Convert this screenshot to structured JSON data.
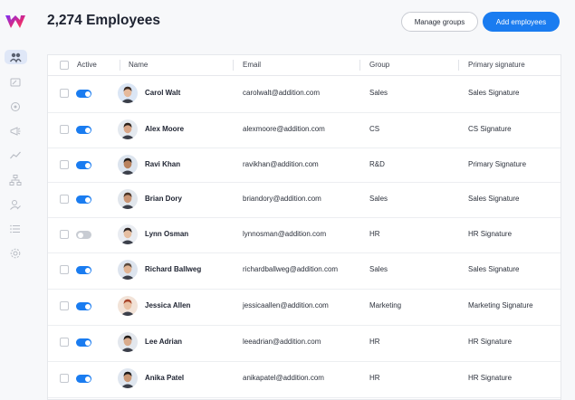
{
  "header": {
    "title": "2,274 Employees",
    "manage_label": "Manage groups",
    "add_label": "Add employees"
  },
  "colors": {
    "accent": "#1a7cf0",
    "toggle_on": "#1a7cf0",
    "toggle_off": "#c8ccd3"
  },
  "sidebar": {
    "items": [
      {
        "icon": "team-icon",
        "active": true
      },
      {
        "icon": "signature-icon"
      },
      {
        "icon": "badge-icon"
      },
      {
        "icon": "megaphone-icon"
      },
      {
        "icon": "analytics-icon"
      },
      {
        "icon": "hierarchy-icon"
      },
      {
        "icon": "user-edit-icon"
      },
      {
        "icon": "list-icon"
      },
      {
        "icon": "settings-icon"
      }
    ]
  },
  "table": {
    "columns": [
      "Active",
      "Name",
      "Email",
      "Group",
      "Primary signature"
    ],
    "rows": [
      {
        "active": true,
        "name": "Carol Walt",
        "email": "carolwalt@addition.com",
        "group": "Sales",
        "signature": "Sales Signature"
      },
      {
        "active": true,
        "name": "Alex Moore",
        "email": "alexmoore@addition.com",
        "group": "CS",
        "signature": "CS Signature"
      },
      {
        "active": true,
        "name": "Ravi Khan",
        "email": "ravikhan@addition.com",
        "group": "R&D",
        "signature": "Primary Signature"
      },
      {
        "active": true,
        "name": "Brian Dory",
        "email": "briandory@addition.com",
        "group": "Sales",
        "signature": "Sales Signature"
      },
      {
        "active": false,
        "name": "Lynn Osman",
        "email": "lynnosman@addition.com",
        "group": "HR",
        "signature": "HR Signature"
      },
      {
        "active": true,
        "name": "Richard Ballweg",
        "email": "richardballweg@addition.com",
        "group": "Sales",
        "signature": "Sales Signature"
      },
      {
        "active": true,
        "name": "Jessica Allen",
        "email": "jessicaallen@addition.com",
        "group": "Marketing",
        "signature": "Marketing Signature"
      },
      {
        "active": true,
        "name": "Lee Adrian",
        "email": "leeadrian@addition.com",
        "group": "HR",
        "signature": "HR Signature"
      },
      {
        "active": true,
        "name": "Anika Patel",
        "email": "anikapatel@addition.com",
        "group": "HR",
        "signature": "HR Signature"
      }
    ]
  }
}
